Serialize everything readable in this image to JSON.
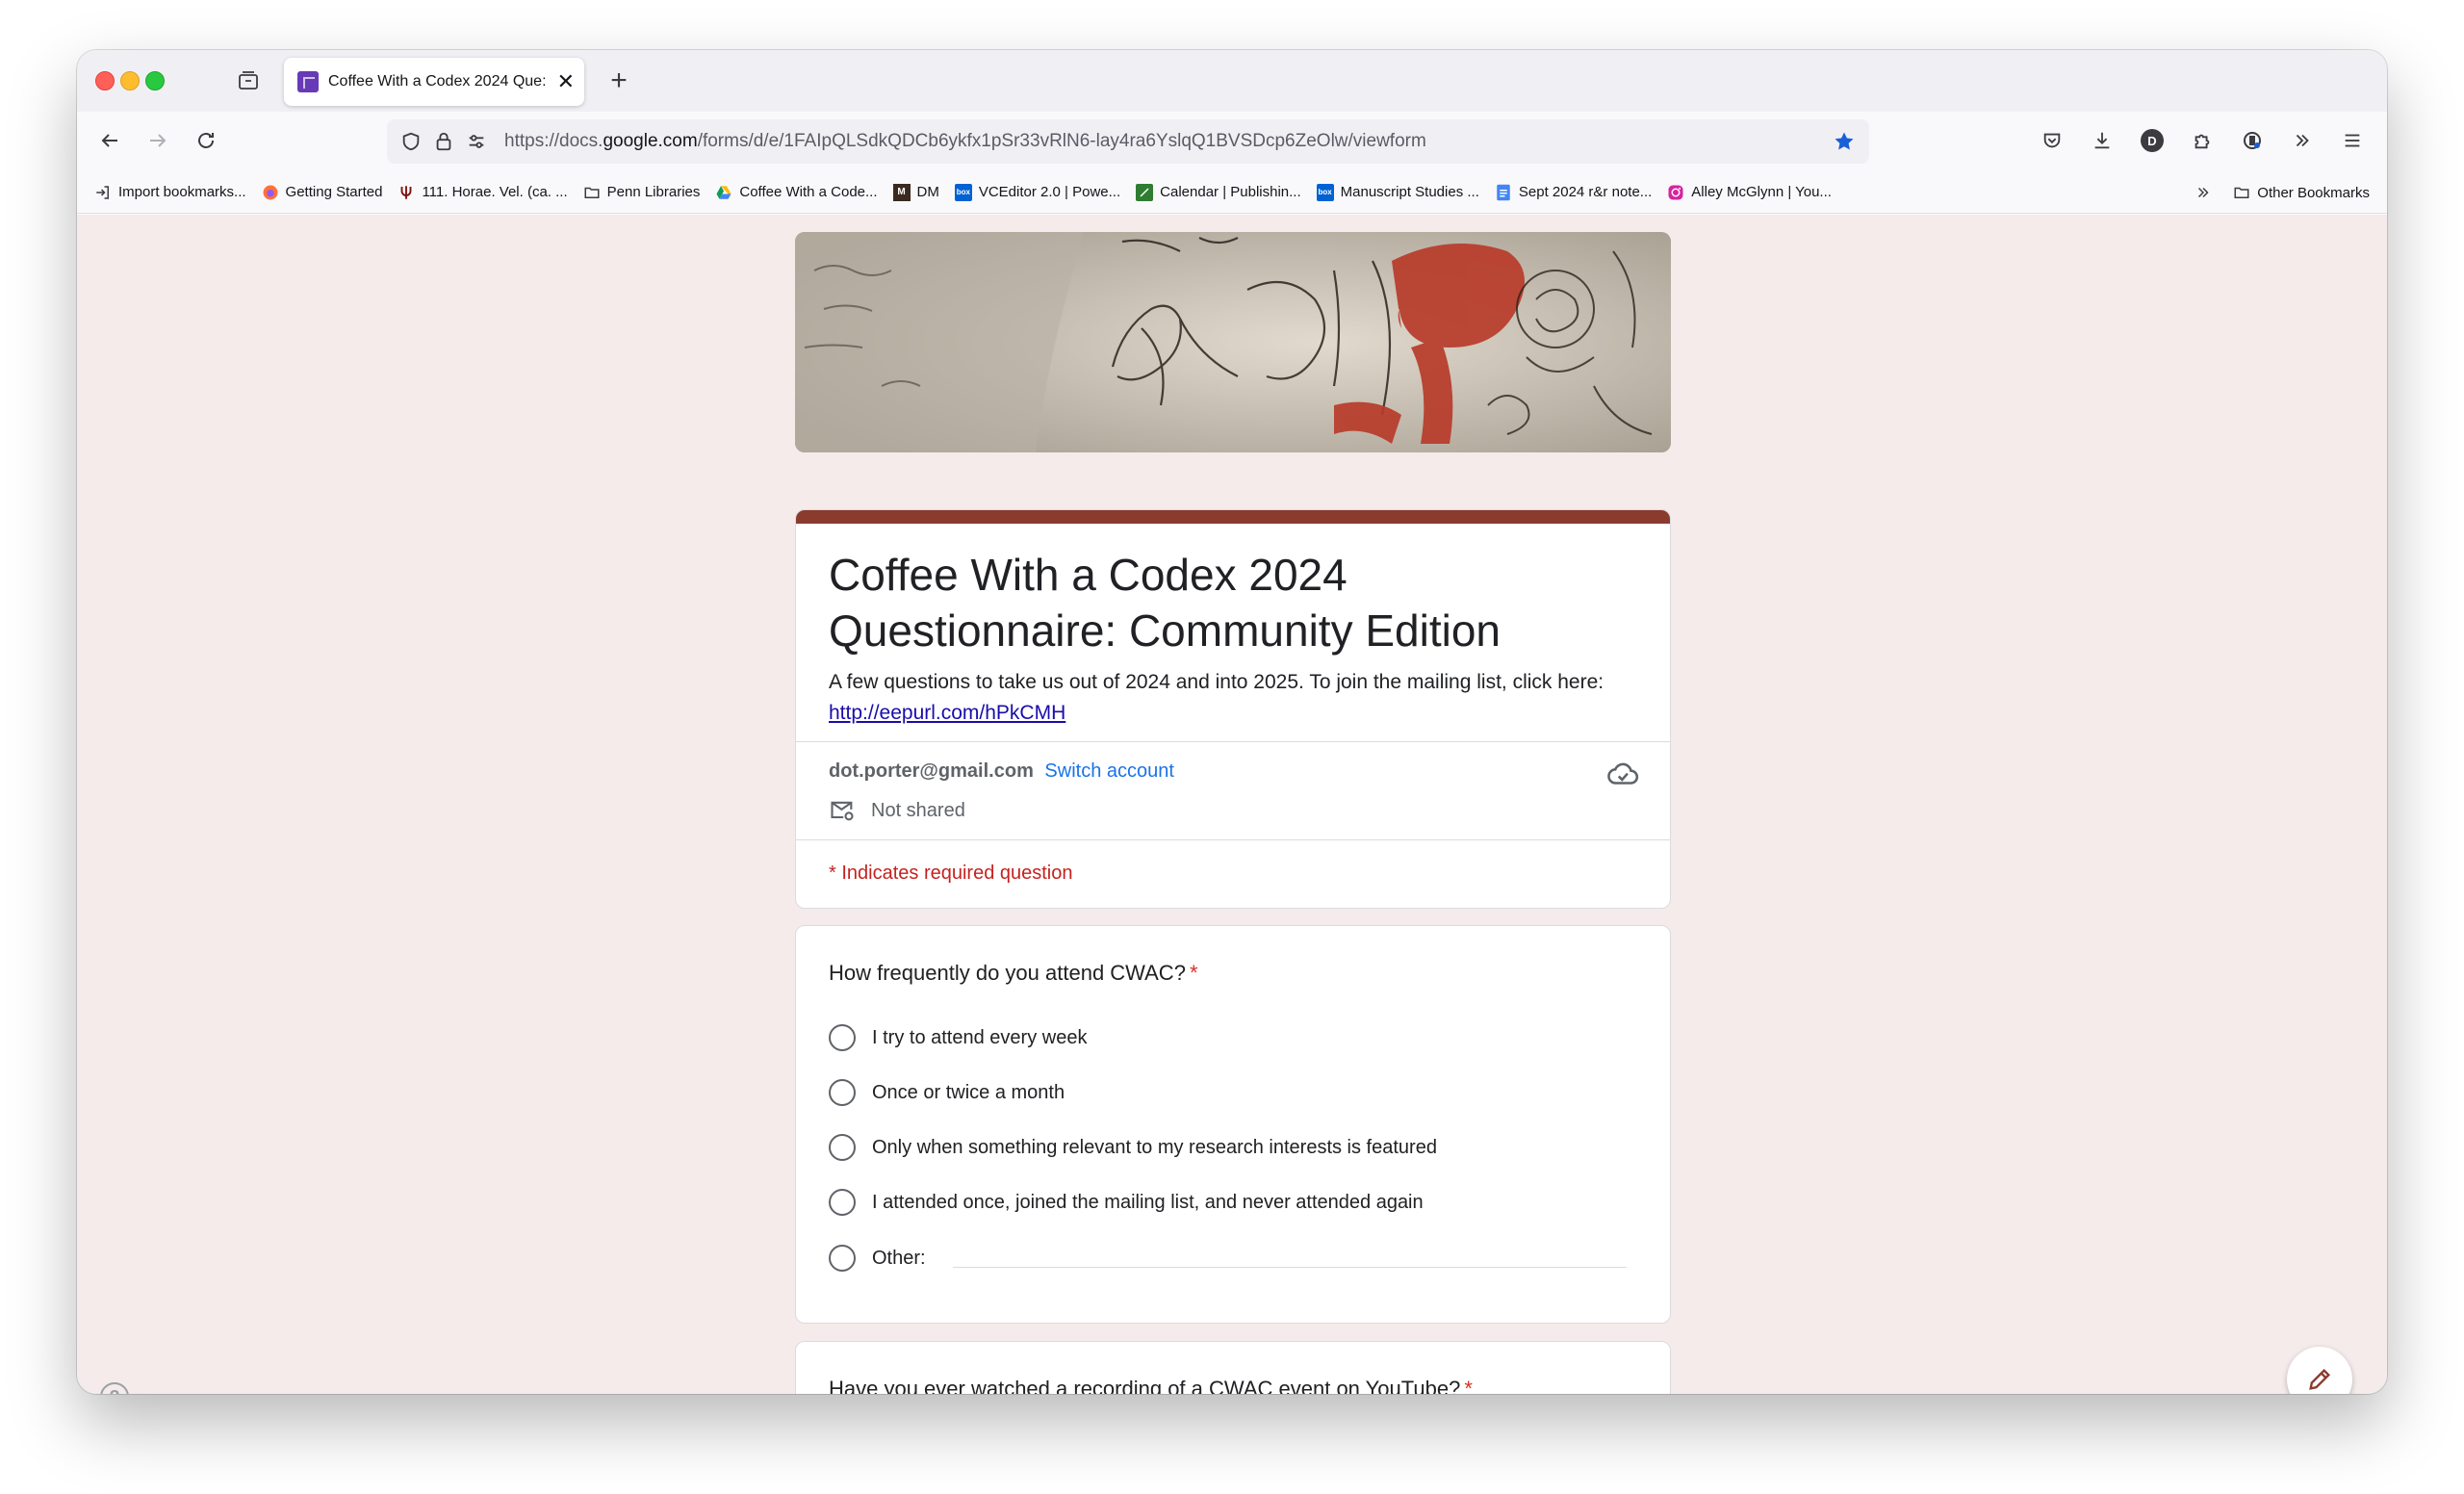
{
  "browser": {
    "tab": {
      "title": "Coffee With a Codex 2024 Que:",
      "close": "✕"
    },
    "new_tab": "+",
    "url": {
      "prefix": "https://docs.",
      "host": "google.com",
      "path": "/forms/d/e/1FAIpQLSdkQDCb6ykfx1pSr33vRlN6-lay4ra6YslqQ1BVSDcp6ZeOlw/viewform"
    },
    "toolbar_avatar": "D",
    "bookmarks": [
      {
        "label": "Import bookmarks...",
        "icon": "import-icon"
      },
      {
        "label": "Getting Started",
        "icon": "firefox-icon"
      },
      {
        "label": "111. Horae. Vel. (ca. ...",
        "icon": "trident-icon"
      },
      {
        "label": "Penn Libraries",
        "icon": "folder-icon"
      },
      {
        "label": "Coffee With a Code...",
        "icon": "drive-icon"
      },
      {
        "label": "DM",
        "icon": "dm-icon"
      },
      {
        "label": "VCEditor 2.0 | Powe...",
        "icon": "box-icon"
      },
      {
        "label": "Calendar | Publishin...",
        "icon": "calendar-icon"
      },
      {
        "label": "Manuscript Studies ...",
        "icon": "box-icon"
      },
      {
        "label": "Sept 2024 r&r note...",
        "icon": "docs-icon"
      },
      {
        "label": "Alley McGlynn | You...",
        "icon": "instagram-icon"
      }
    ],
    "other_bookmarks": "Other Bookmarks"
  },
  "form": {
    "title": "Coffee With a Codex 2024 Questionnaire: Community Edition",
    "description": "A few questions to take us out of 2024 and into 2025. To join the mailing list, click here:",
    "link": "http://eepurl.com/hPkCMH",
    "account_email": "dot.porter@gmail.com",
    "switch_account": "Switch account",
    "not_shared": "Not shared",
    "required_note": "* Indicates required question",
    "questions": [
      {
        "title": "How frequently do you attend CWAC?",
        "required_mark": "*",
        "options": [
          "I try to attend every week",
          "Once or twice a month",
          "Only when something relevant to my research interests is featured",
          "I attended once, joined the mailing list, and never attended again",
          "Other:"
        ]
      },
      {
        "title": "Have you ever watched a recording of a CWAC event on YouTube?",
        "required_mark": "*"
      }
    ]
  },
  "colors": {
    "theme": "#8b3a2e",
    "page_bg": "#f4ebea",
    "link": "#1a0dab",
    "required": "#d93025",
    "switch": "#1a73e8"
  },
  "help": "?"
}
